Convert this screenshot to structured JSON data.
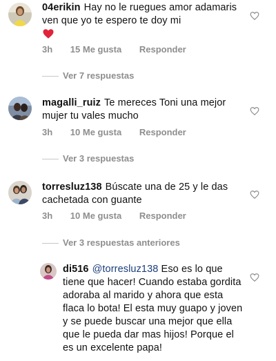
{
  "comments": [
    {
      "username": "04erikin",
      "text": "Hay no le ruegues amor adamaris ven que yo te espero te doy mi",
      "emoji": "❤️",
      "time": "3h",
      "likes": "15 Me gusta",
      "reply_label": "Responder",
      "view_replies": "Ver 7 respuestas"
    },
    {
      "username": "magalli_ruiz",
      "text": "Te mereces Toni una mejor mujer tu vales mucho",
      "time": "3h",
      "likes": "10 Me gusta",
      "reply_label": "Responder",
      "view_replies": "Ver 3 respuestas"
    },
    {
      "username": "torresluz138",
      "text": "Búscate una de 25 y le das cachetada con guante",
      "time": "3h",
      "likes": "10 Me gusta",
      "reply_label": "Responder",
      "view_replies": "Ver 3 respuestas anteriores"
    },
    {
      "username": "di516",
      "mention": "@torresluz138",
      "text": "Eso es lo que tiene que hacer! Cuando estaba gordita adoraba al marido y ahora que esta flaca lo bota! El esta muy guapo y joven y se puede buscar una mejor que ella que le pueda dar mas hijos! Porque el es un excelente papa!"
    }
  ],
  "colors": {
    "meta": "#8e8e8e",
    "mention": "#1a3d7c",
    "heart_emoji": "#e0243a"
  },
  "icons": {
    "like": "heart-outline-icon"
  }
}
